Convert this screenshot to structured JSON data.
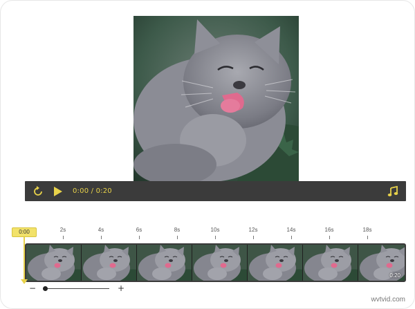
{
  "player": {
    "current_time": "0:00",
    "separator": " / ",
    "total_time": "0:20",
    "accent_color": "#e8d24a",
    "bar_color": "#3b3b3b"
  },
  "icons": {
    "loop": "loop-icon",
    "play": "play-icon",
    "music": "music-note-icon"
  },
  "timeline": {
    "playhead_label": "0:00",
    "ticks": [
      "2s",
      "4s",
      "6s",
      "8s",
      "10s",
      "12s",
      "14s",
      "16s",
      "18s"
    ],
    "frame_count": 7,
    "duration_label": "0:20",
    "zoom_minus": "−",
    "zoom_plus": "+"
  },
  "watermark": "wvtvid.com"
}
